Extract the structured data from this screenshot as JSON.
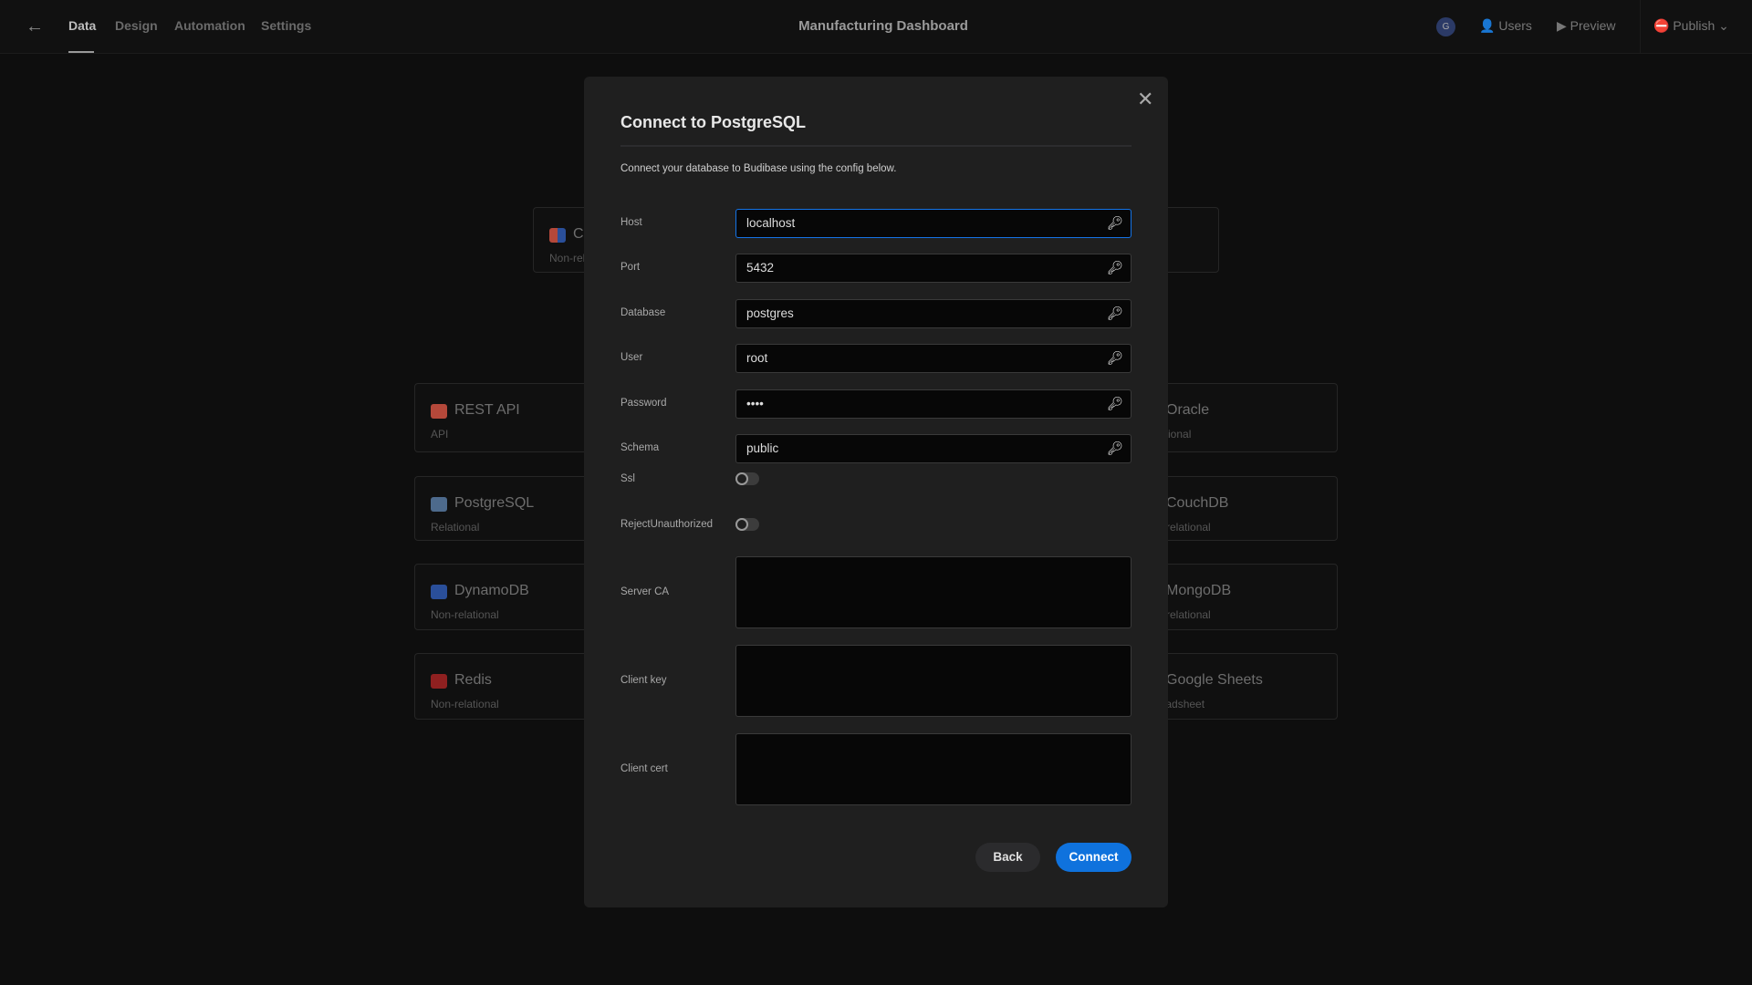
{
  "header": {
    "back_icon": "arrow-left-icon",
    "tabs": [
      {
        "label": "Data",
        "active": true
      },
      {
        "label": "Design"
      },
      {
        "label": "Automation"
      },
      {
        "label": "Settings"
      }
    ],
    "app_title": "Manufacturing Dashboard",
    "avatar_initial": "G",
    "users_label": "Users",
    "preview_label": "Preview",
    "publish_label": "Publish"
  },
  "background": {
    "top_card": {
      "label": "Cr",
      "subtitle": "Non-rela"
    },
    "left_cards": [
      {
        "name": "REST API",
        "type": "API",
        "color": "#b4483a"
      },
      {
        "name": "PostgreSQL",
        "type": "Relational",
        "color": "#4d6a8c"
      },
      {
        "name": "DynamoDB",
        "type": "Non-relational",
        "color": "#2a4f9a"
      },
      {
        "name": "Redis",
        "type": "Non-relational",
        "color": "#8f2020"
      }
    ],
    "right_cards": [
      {
        "name": "Oracle",
        "type": "Relational"
      },
      {
        "name": "CouchDB",
        "type": "Non-relational"
      },
      {
        "name": "MongoDB",
        "type": "Non-relational"
      },
      {
        "name": "Google Sheets",
        "type": "Spreadsheet"
      }
    ]
  },
  "modal": {
    "title": "Connect to PostgreSQL",
    "description": "Connect your database to Budibase using the config below.",
    "fields": [
      {
        "label": "Host",
        "value": "localhost"
      },
      {
        "label": "Port",
        "value": "5432"
      },
      {
        "label": "Database",
        "value": "postgres"
      },
      {
        "label": "User",
        "value": "root"
      },
      {
        "label": "Password",
        "value": "••••"
      },
      {
        "label": "Schema",
        "value": "public"
      }
    ],
    "toggles": [
      {
        "label": "Ssl",
        "on": false
      },
      {
        "label": "RejectUnauthorized",
        "on": false
      }
    ],
    "textareas": [
      {
        "label": "Server CA",
        "value": ""
      },
      {
        "label": "Client key",
        "value": ""
      },
      {
        "label": "Client cert",
        "value": ""
      }
    ],
    "back_label": "Back",
    "connect_label": "Connect",
    "accent": "#0f72dd"
  }
}
